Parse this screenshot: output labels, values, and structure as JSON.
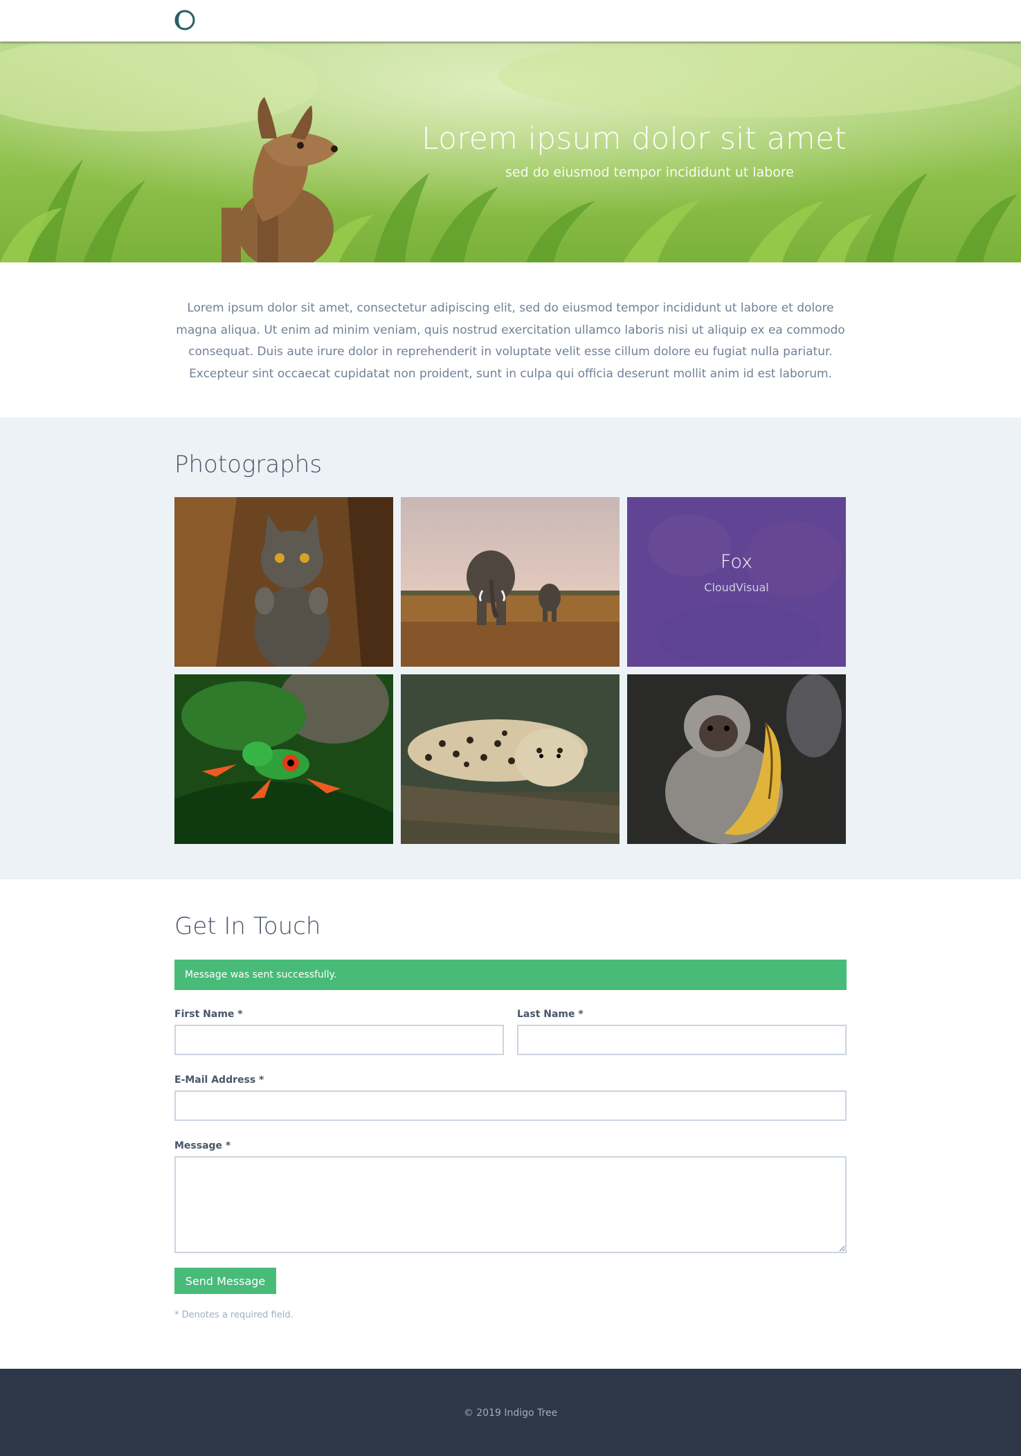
{
  "header": {
    "logo_icon": "half-moon-logo-icon"
  },
  "hero": {
    "title": "Lorem ipsum dolor sit amet",
    "subtitle": "sed do eiusmod tempor incididunt ut labore"
  },
  "intro": {
    "text": "Lorem ipsum dolor sit amet, consectetur adipiscing elit, sed do eiusmod tempor incididunt ut labore et dolore magna aliqua. Ut enim ad minim veniam, quis nostrud exercitation ullamco laboris nisi ut aliquip ex ea commodo consequat. Duis aute irure dolor in reprehenderit in voluptate velit esse cillum dolore eu fugiat nulla pariatur. Excepteur sint occaecat cupidatat non proident, sunt in culpa qui officia deserunt mollit anim id est laborum."
  },
  "photos": {
    "title": "Photographs",
    "items": [
      {
        "subject": "cat"
      },
      {
        "subject": "elephant"
      },
      {
        "subject": "fox",
        "caption": "Fox",
        "credit": "CloudVisual"
      },
      {
        "subject": "frog"
      },
      {
        "subject": "leopard"
      },
      {
        "subject": "monkey"
      }
    ]
  },
  "contact": {
    "title": "Get In Touch",
    "alert": "Message was sent successfully.",
    "first_name_label": "First Name *",
    "last_name_label": "Last Name *",
    "email_label": "E-Mail Address *",
    "message_label": "Message *",
    "first_name_value": "",
    "last_name_value": "",
    "email_value": "",
    "message_value": "",
    "send_label": "Send Message",
    "required_note": "* Denotes a required field."
  },
  "footer": {
    "text": "© 2019 Indigo Tree"
  },
  "colors": {
    "accent_green": "#48bb78",
    "overlay_purple": "#5844ac",
    "footer_bg": "#2d3748",
    "section_bg": "#edf2f7"
  }
}
